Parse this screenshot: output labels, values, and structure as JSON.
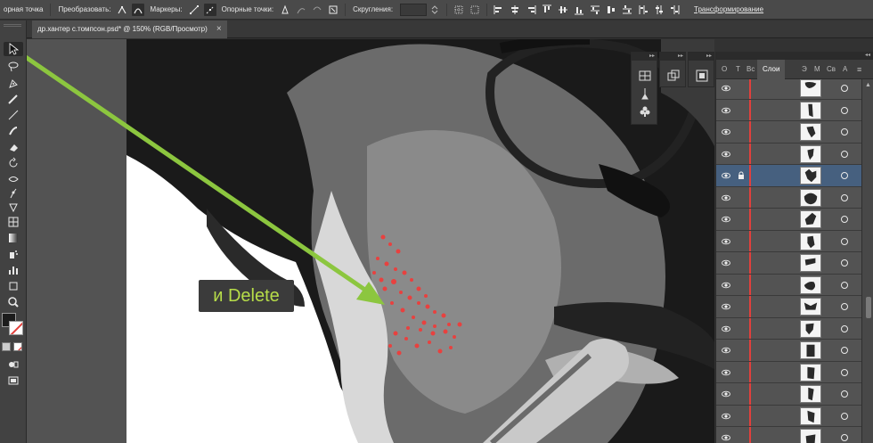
{
  "control_bar": {
    "anchor_point_label": "орная точка",
    "convert_label": "Преобразовать:",
    "handles_label": "Маркеры:",
    "anchors_label": "Опорные точки:",
    "corners_label": "Скругления:",
    "transform_label": "Трансформирование"
  },
  "document_tab": {
    "title": "др.хантер с.томпсон.psd* @ 150% (RGB/Просмотр)",
    "close": "×"
  },
  "callout": {
    "text": "и Delete",
    "color": "#b7dd49"
  },
  "arrow_color": "#8cc63f",
  "dock": {
    "collapse_glyph": "▸▸"
  },
  "layers_panel": {
    "collapse_glyph": "◂◂",
    "tabs": [
      "О",
      "Т",
      "Вс",
      "Слои",
      "Э",
      "М",
      "Св",
      "А"
    ],
    "active_tab": "Слои",
    "selected_row_index": 4,
    "locked_row_index": 4,
    "layer_color": "#e2403c",
    "selection_color": "#46607f",
    "rows": 17
  },
  "tools": [
    "selection-tool",
    "lasso-tool",
    "pen-tool",
    "pencil-tool",
    "line-tool",
    "blob-brush-tool",
    "eraser-tool",
    "rotate-tool",
    "width-tool",
    "puppet-warp-tool",
    "pin-tool",
    "perspective-grid-tool",
    "gradient-tool",
    "symbol-sprayer-tool",
    "column-graph-tool",
    "artboard-tool",
    "zoom-tool"
  ]
}
